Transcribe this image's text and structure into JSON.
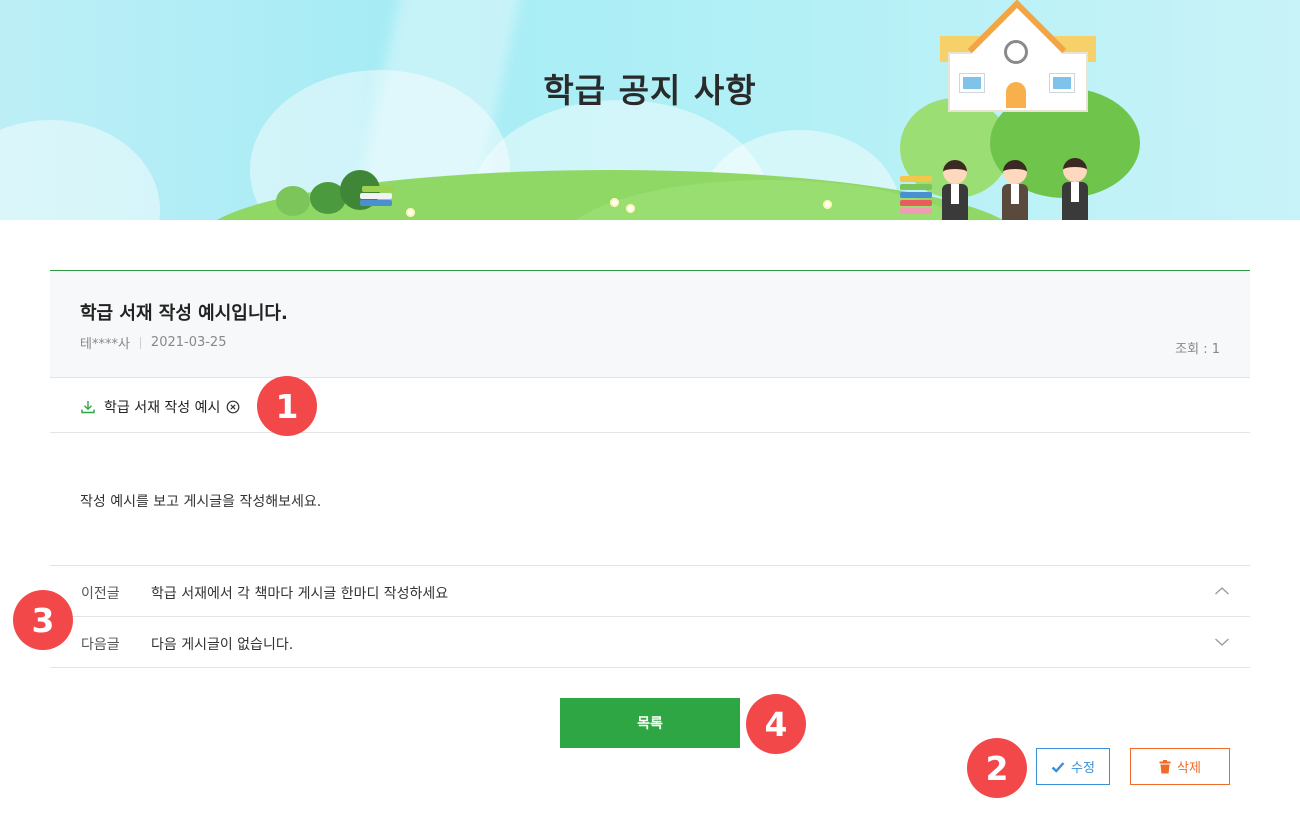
{
  "banner": {
    "title": "학급 공지 사항"
  },
  "post": {
    "title": "학급 서재 작성 예시입니다.",
    "author": "테****사",
    "date": "2021-03-25",
    "views": "조회 : 1",
    "attachment_name": "학급 서재 작성 예시",
    "body": "작성 예시를 보고 게시글을 작성해보세요."
  },
  "navigation": {
    "prev_label": "이전글",
    "prev_title": "학급 서재에서 각 책마다 게시글 한마디 작성하세요",
    "next_label": "다음글",
    "next_title": "다음 게시글이 없습니다."
  },
  "buttons": {
    "list_label": "목록",
    "edit_label": "수정",
    "delete_label": "삭제"
  },
  "markers": [
    "1",
    "2",
    "3",
    "4"
  ],
  "colors": {
    "accent_green": "#2fa644",
    "edit_blue": "#3b8fd9",
    "delete_orange": "#f06a2a",
    "marker_red": "#f2484a"
  },
  "icons": {
    "attachment": "download-icon",
    "attachment_remove": "circle-x-icon",
    "prev": "chevron-up-icon",
    "next": "chevron-down-icon",
    "edit": "check-icon",
    "delete": "trash-icon"
  }
}
